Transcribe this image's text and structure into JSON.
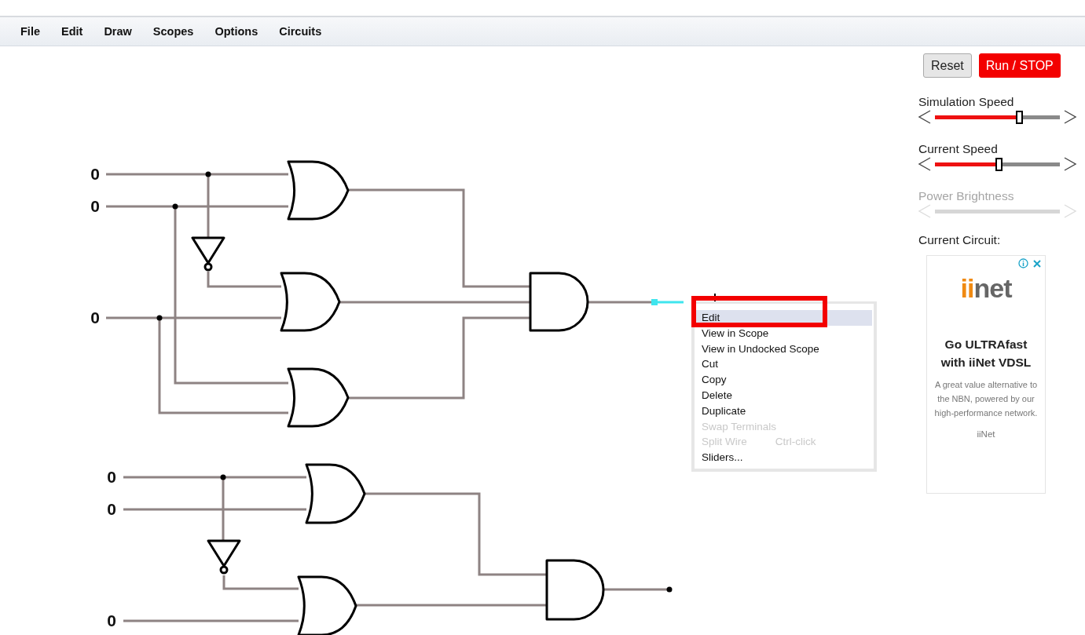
{
  "menu_bar": [
    {
      "label": "File"
    },
    {
      "label": "Edit"
    },
    {
      "label": "Draw"
    },
    {
      "label": "Scopes"
    },
    {
      "label": "Options"
    },
    {
      "label": "Circuits"
    }
  ],
  "circuit": {
    "inputs": [
      "0",
      "0",
      "0",
      "0",
      "0",
      "0"
    ]
  },
  "context_menu": {
    "items": [
      {
        "label": "Edit",
        "selected": true,
        "disabled": false
      },
      {
        "label": "View in Scope",
        "selected": false,
        "disabled": false
      },
      {
        "label": "View in Undocked Scope",
        "selected": false,
        "disabled": false
      },
      {
        "label": "Cut",
        "selected": false,
        "disabled": false
      },
      {
        "label": "Copy",
        "selected": false,
        "disabled": false
      },
      {
        "label": "Delete",
        "selected": false,
        "disabled": false
      },
      {
        "label": "Duplicate",
        "selected": false,
        "disabled": false
      },
      {
        "label": "Swap Terminals",
        "selected": false,
        "disabled": true
      },
      {
        "label": "Split Wire",
        "shortcut": "Ctrl-click",
        "selected": false,
        "disabled": true
      },
      {
        "label": "Sliders...",
        "selected": false,
        "disabled": false
      }
    ],
    "annotation": true
  },
  "side_panel": {
    "buttons": [
      {
        "label": "Reset",
        "kind": "plain"
      },
      {
        "label": "Run / STOP",
        "kind": "primary"
      }
    ],
    "sliders": [
      {
        "label": "Simulation Speed",
        "level": 0.67,
        "disabled": false
      },
      {
        "label": "Current Speed",
        "level": 0.51,
        "disabled": false
      },
      {
        "label": "Power Brightness",
        "disabled": true
      }
    ],
    "current_circuit_label": "Current Circuit:",
    "ad": {
      "logo": "iinet",
      "headline": "Go ULTRAfast with iiNet VDSL",
      "body": "A great value alternative to the NBN, powered by our high-performance network.",
      "advertiser": "iiNet"
    }
  }
}
